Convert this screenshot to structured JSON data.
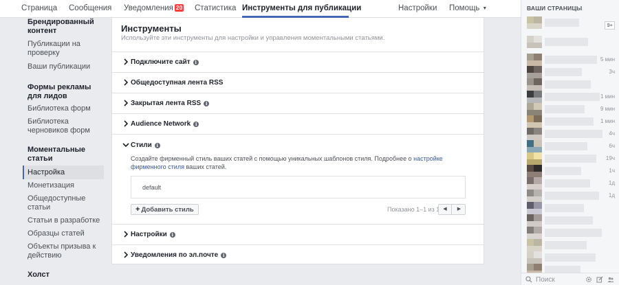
{
  "nav": {
    "tabs": [
      {
        "label": "Страница"
      },
      {
        "label": "Сообщения"
      },
      {
        "label": "Уведомления",
        "badge": "20"
      },
      {
        "label": "Статистика"
      },
      {
        "label": "Инструменты для публикации"
      },
      {
        "label": "Настройки"
      },
      {
        "label": "Помощь"
      }
    ],
    "active_tab": "Инструменты для публикации"
  },
  "sidebar": {
    "sections": [
      {
        "heading": "Брендированный контент",
        "items": [
          "Публикации на проверку",
          "Ваши публикации"
        ]
      },
      {
        "heading": "Формы рекламы для лидов",
        "items": [
          "Библиотека форм",
          "Библиотека черновиков форм"
        ]
      },
      {
        "heading": "Моментальные статьи",
        "items": [
          "Настройка",
          "Монетизация",
          "Общедоступные статьи",
          "Статьи в разработке",
          "Образцы статей",
          "Объекты призыва к действию"
        ]
      },
      {
        "heading": "Холст",
        "items": []
      }
    ],
    "selected": "Настройка"
  },
  "main": {
    "title": "Инструменты",
    "subtitle": "Используйте эти инструменты для настройки и управления моментальными статьями.",
    "rows": [
      {
        "label": "Подключите сайт"
      },
      {
        "label": "Общедоступная лента RSS"
      },
      {
        "label": "Закрытая лента RSS"
      },
      {
        "label": "Audience Network"
      }
    ],
    "styles": {
      "label": "Стили",
      "desc_before": "Создайте фирменный стиль ваших статей с помощью уникальных шаблонов стиля. Подробнее о ",
      "desc_link": "настройке фирменного стиля",
      "desc_after": " ваших статей.",
      "style_name": "default",
      "add_label": "Добавить стиль",
      "pager": "Показано 1–1 из 1"
    },
    "bottom_rows": [
      {
        "label": "Настройки"
      },
      {
        "label": "Уведомления по эл.почте"
      }
    ]
  },
  "right": {
    "title": "ВАШИ СТРАНИЦЫ",
    "count": "9+",
    "times": [
      "",
      "",
      "5 мин",
      "3ч",
      "",
      "1 мин",
      "9 мин",
      "1 мин",
      "4ч",
      "6ч",
      "19ч",
      "1ч",
      "1д",
      "1д"
    ],
    "search_placeholder": "Поиск"
  },
  "colors": {
    "accent": "#4267b2",
    "link": "#365899",
    "badge": "#fa3e3e"
  }
}
